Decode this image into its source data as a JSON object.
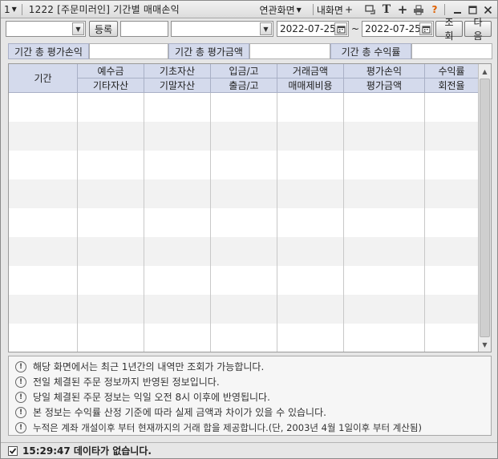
{
  "titlebar": {
    "screen_number": "1",
    "title": "1222 [주문미러인] 기간별 매매손익",
    "related_screens": "연관화면",
    "my_screen": "내화면"
  },
  "toolbar": {
    "account_value": "",
    "register_label": "등록",
    "password_value": "",
    "selector_value": "",
    "date_from": "2022-07-25",
    "tilde": "~",
    "date_to": "2022-07-25",
    "query_label": "조회",
    "next_label": "다음"
  },
  "summary": {
    "total_pnl_label": "기간 총 평가손익",
    "total_pnl_value": "",
    "total_eval_label": "기간 총 평가금액",
    "total_eval_value": "",
    "total_return_label": "기간 총 수익률",
    "total_return_value": ""
  },
  "grid": {
    "period": "기간",
    "deposit": "예수금",
    "other_assets": "기타자산",
    "base_assets": "기초자산",
    "end_assets": "기말자산",
    "deposit_in": "입금/고",
    "withdraw_out": "출금/고",
    "trade_amount": "거래금액",
    "trade_fees": "매매제비용",
    "eval_pnl": "평가손익",
    "eval_amount": "평가금액",
    "return_rate": "수익률",
    "turnover": "회전율"
  },
  "notices": [
    "해당 화면에서는 최근 1년간의 내역만 조회가 가능합니다.",
    "전일 체결된 주문 정보까지 반영된 정보입니다.",
    "당일 체결된 주문 정보는 익일 오전 8시 이후에 반영됩니다.",
    "본 정보는 수익률 산정 기준에 따라 실제 금액과 차이가 있을 수 있습니다.",
    "누적은 계좌 개설이후 부터 현재까지의 거래 합을 제공합니다.(단, 2003년 4월 1일이후 부터 계산됨)"
  ],
  "status": {
    "message": "15:29:47 데이타가 없습니다."
  }
}
